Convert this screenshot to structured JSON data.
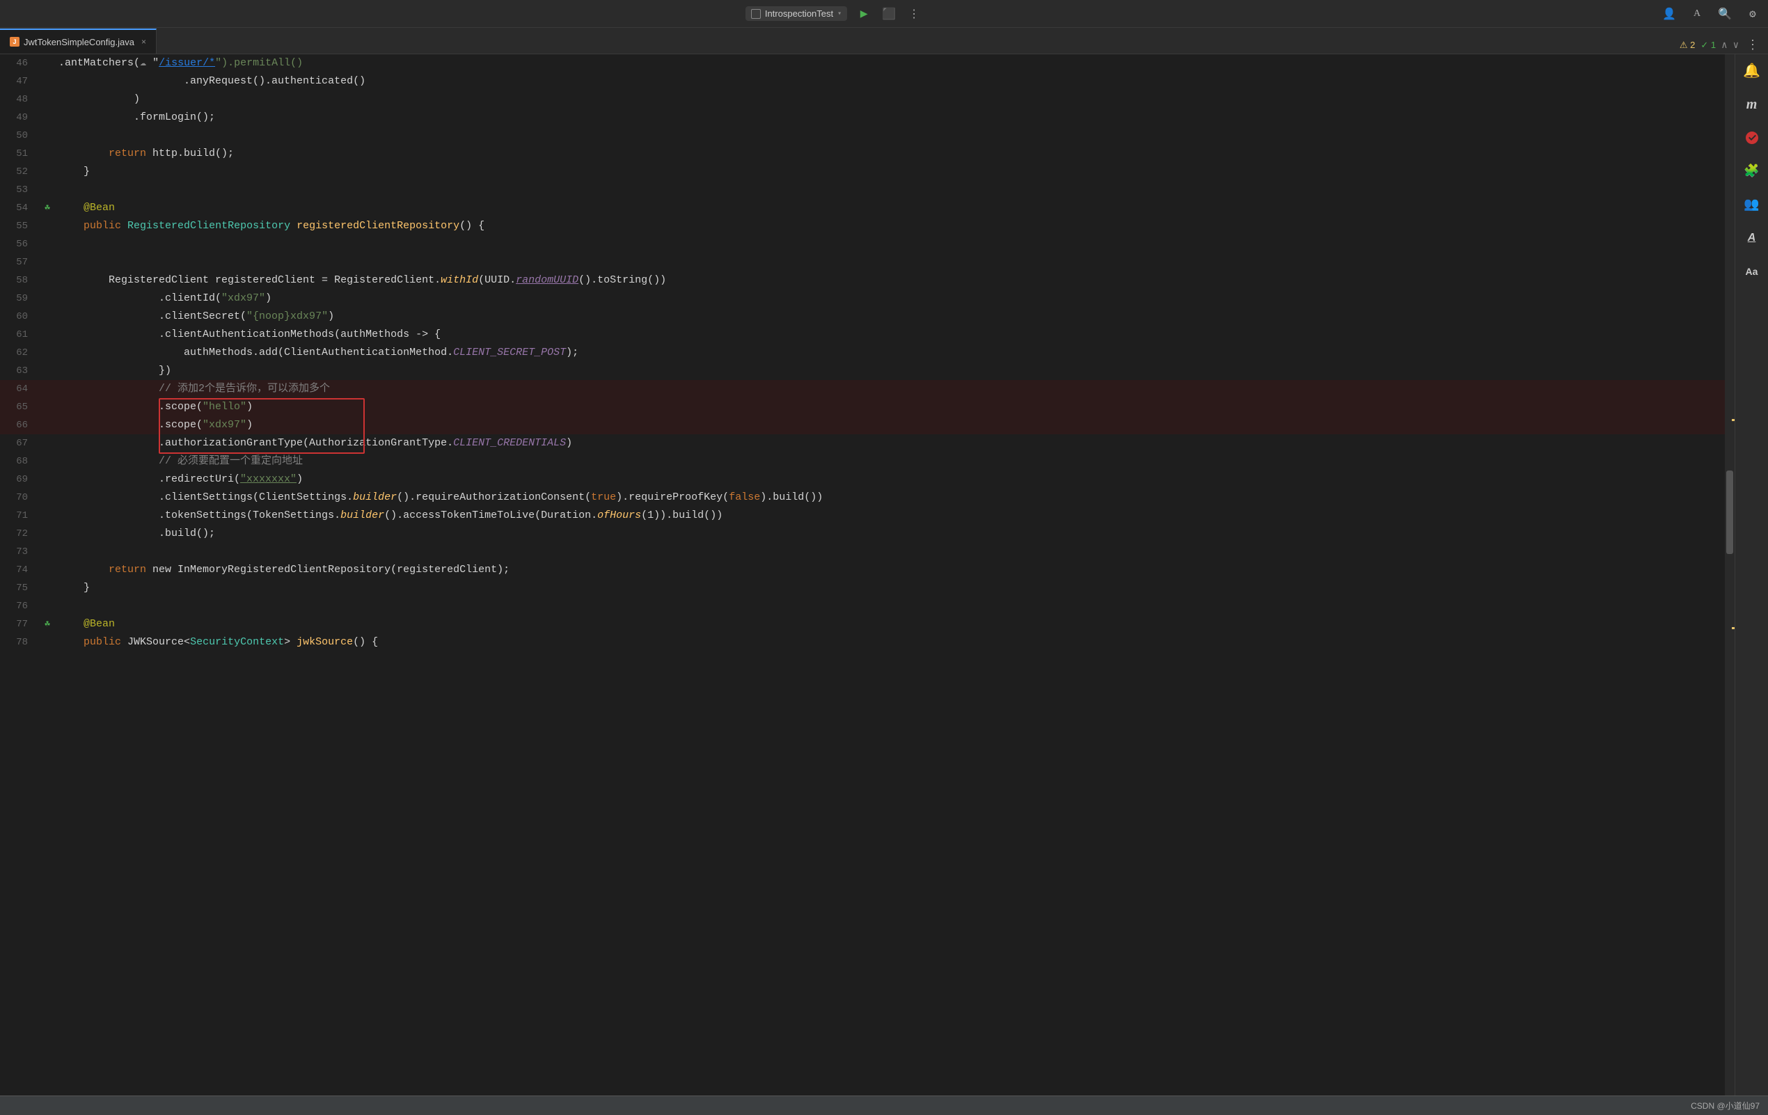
{
  "topbar": {
    "run_config_label": "IntrospectionTest",
    "run_icon": "▶",
    "debug_icon": "🐛",
    "more_icon": "⋮",
    "profile_icon": "👤",
    "font_icon": "A",
    "search_icon": "🔍",
    "settings_icon": "⚙"
  },
  "tab": {
    "filename": "JwtTokenSimpleConfig.java",
    "close_icon": "×",
    "more_icon": "⋮"
  },
  "warnings": {
    "warning_count": "⚠ 2",
    "ok_count": "✓ 1"
  },
  "code_lines": [
    {
      "num": "46",
      "gutter": "",
      "code": "                    .antMatchers(",
      "parts": [
        {
          "text": "                    .antMatchers(",
          "cls": ""
        },
        {
          "text": "☁",
          "cls": "comment"
        },
        {
          "text": " \"",
          "cls": ""
        },
        {
          "text": "/issuer/*",
          "cls": "link"
        },
        {
          "text": "\").permitAll()",
          "cls": "str2"
        }
      ]
    },
    {
      "num": "47",
      "gutter": "",
      "parts": [
        {
          "text": "                    .anyRequest().authenticated()",
          "cls": ""
        }
      ]
    },
    {
      "num": "48",
      "gutter": "",
      "parts": [
        {
          "text": "            )",
          "cls": ""
        }
      ]
    },
    {
      "num": "49",
      "gutter": "",
      "parts": [
        {
          "text": "            .formLogin();",
          "cls": ""
        }
      ]
    },
    {
      "num": "50",
      "gutter": "",
      "parts": [
        {
          "text": "",
          "cls": ""
        }
      ]
    },
    {
      "num": "51",
      "gutter": "",
      "parts": [
        {
          "text": "        ",
          "cls": ""
        },
        {
          "text": "return",
          "cls": "kw"
        },
        {
          "text": " http.build();",
          "cls": ""
        }
      ]
    },
    {
      "num": "52",
      "gutter": "",
      "parts": [
        {
          "text": "    }",
          "cls": ""
        }
      ]
    },
    {
      "num": "53",
      "gutter": "",
      "parts": [
        {
          "text": "",
          "cls": ""
        }
      ]
    },
    {
      "num": "54",
      "gutter": "bean",
      "parts": [
        {
          "text": "    ",
          "cls": ""
        },
        {
          "text": "@Bean",
          "cls": "ann"
        }
      ]
    },
    {
      "num": "55",
      "gutter": "",
      "parts": [
        {
          "text": "    ",
          "cls": ""
        },
        {
          "text": "public",
          "cls": "kw"
        },
        {
          "text": " RegisteredClientRepository ",
          "cls": "type"
        },
        {
          "text": "registeredClientRepository",
          "cls": "fn"
        },
        {
          "text": "() {",
          "cls": ""
        }
      ]
    },
    {
      "num": "56",
      "gutter": "",
      "parts": [
        {
          "text": "",
          "cls": ""
        }
      ]
    },
    {
      "num": "57",
      "gutter": "",
      "parts": [
        {
          "text": "",
          "cls": ""
        }
      ]
    },
    {
      "num": "58",
      "gutter": "",
      "parts": [
        {
          "text": "        RegisteredClient registeredClient = RegisteredClient.",
          "cls": ""
        },
        {
          "text": "withId",
          "cls": "method"
        },
        {
          "text": "(UUID.",
          "cls": ""
        },
        {
          "text": "randomUUID",
          "cls": "const-italic underline"
        },
        {
          "text": "().toString())",
          "cls": ""
        }
      ]
    },
    {
      "num": "59",
      "gutter": "",
      "parts": [
        {
          "text": "                .clientId(",
          "cls": ""
        },
        {
          "text": "\"xdx97\"",
          "cls": "str"
        },
        {
          "text": ")",
          "cls": ""
        }
      ]
    },
    {
      "num": "60",
      "gutter": "",
      "parts": [
        {
          "text": "                .clientSecret(",
          "cls": ""
        },
        {
          "text": "\"{noop}xdx97\"",
          "cls": "str"
        },
        {
          "text": ")",
          "cls": ""
        }
      ]
    },
    {
      "num": "61",
      "gutter": "",
      "parts": [
        {
          "text": "                .clientAuthenticationMethods(authMethods -> ",
          "cls": ""
        },
        {
          "text": "{",
          "cls": ""
        }
      ]
    },
    {
      "num": "62",
      "gutter": "",
      "parts": [
        {
          "text": "                    authMethods.add(ClientAuthenticationMethod.",
          "cls": ""
        },
        {
          "text": "CLIENT_SECRET_POST",
          "cls": "const-italic"
        },
        {
          "text": ");",
          "cls": ""
        }
      ]
    },
    {
      "num": "63",
      "gutter": "",
      "parts": [
        {
          "text": "                })",
          "cls": ""
        }
      ]
    },
    {
      "num": "64",
      "gutter": "",
      "parts": [
        {
          "text": "                ",
          "cls": ""
        },
        {
          "text": "// 添加2个是告诉你，可以添加多个",
          "cls": "comment"
        },
        {
          "text": "",
          "cls": ""
        }
      ]
    },
    {
      "num": "65",
      "gutter": "",
      "parts": [
        {
          "text": "                .scope(",
          "cls": ""
        },
        {
          "text": "\"hello\"",
          "cls": "str"
        },
        {
          "text": ")",
          "cls": ""
        }
      ]
    },
    {
      "num": "66",
      "gutter": "",
      "parts": [
        {
          "text": "                .scope(",
          "cls": ""
        },
        {
          "text": "\"xdx97\"",
          "cls": "str"
        },
        {
          "text": ")",
          "cls": ""
        }
      ]
    },
    {
      "num": "67",
      "gutter": "",
      "parts": [
        {
          "text": "                .authorizationGrantType(AuthorizationGrantType.",
          "cls": ""
        },
        {
          "text": "CLIENT_CREDENTIALS",
          "cls": "const-italic"
        },
        {
          "text": ")",
          "cls": ""
        }
      ]
    },
    {
      "num": "68",
      "gutter": "",
      "parts": [
        {
          "text": "                ",
          "cls": ""
        },
        {
          "text": "// 必须要配置一个重定向地址",
          "cls": "comment"
        }
      ]
    },
    {
      "num": "69",
      "gutter": "",
      "parts": [
        {
          "text": "                .redirectUri(",
          "cls": ""
        },
        {
          "text": "\"xxxxxxx\"",
          "cls": "str underline"
        },
        {
          "text": ")",
          "cls": ""
        }
      ]
    },
    {
      "num": "70",
      "gutter": "",
      "parts": [
        {
          "text": "                .clientSettings(ClientSettings.",
          "cls": ""
        },
        {
          "text": "builder",
          "cls": "method"
        },
        {
          "text": "().requireAuthorizationConsent(",
          "cls": ""
        },
        {
          "text": "true",
          "cls": "bool"
        },
        {
          "text": ").requireProofKey(",
          "cls": ""
        },
        {
          "text": "false",
          "cls": "bool"
        },
        {
          "text": ").build())",
          "cls": ""
        }
      ]
    },
    {
      "num": "71",
      "gutter": "",
      "parts": [
        {
          "text": "                .tokenSettings(TokenSettings.",
          "cls": ""
        },
        {
          "text": "builder",
          "cls": "method"
        },
        {
          "text": "().accessTokenTimeToLive(Duration.",
          "cls": ""
        },
        {
          "text": "ofHours",
          "cls": "method"
        },
        {
          "text": "(1)).build())",
          "cls": ""
        }
      ]
    },
    {
      "num": "72",
      "gutter": "",
      "parts": [
        {
          "text": "                .build();",
          "cls": ""
        }
      ]
    },
    {
      "num": "73",
      "gutter": "",
      "parts": [
        {
          "text": "",
          "cls": ""
        }
      ]
    },
    {
      "num": "74",
      "gutter": "",
      "parts": [
        {
          "text": "        ",
          "cls": ""
        },
        {
          "text": "return",
          "cls": "kw"
        },
        {
          "text": " new InMemoryRegisteredClientRepository(registeredClient);",
          "cls": ""
        }
      ]
    },
    {
      "num": "75",
      "gutter": "",
      "parts": [
        {
          "text": "    }",
          "cls": ""
        }
      ]
    },
    {
      "num": "76",
      "gutter": "",
      "parts": [
        {
          "text": "",
          "cls": ""
        }
      ]
    },
    {
      "num": "77",
      "gutter": "bean",
      "parts": [
        {
          "text": "    ",
          "cls": ""
        },
        {
          "text": "@Bean",
          "cls": "ann"
        }
      ]
    },
    {
      "num": "78",
      "gutter": "",
      "parts": [
        {
          "text": "    ",
          "cls": ""
        },
        {
          "text": "public",
          "cls": "kw"
        },
        {
          "text": " JWKSource<SecurityContext> ",
          "cls": "type"
        },
        {
          "text": "jwkSource",
          "cls": "fn"
        },
        {
          "text": "() {",
          "cls": ""
        }
      ]
    }
  ],
  "right_tools": [
    {
      "name": "database-icon",
      "symbol": "🗄"
    },
    {
      "name": "maven-icon",
      "symbol": "m"
    },
    {
      "name": "spring-icon",
      "symbol": "🌿"
    },
    {
      "name": "ai-icon",
      "symbol": "🤖"
    },
    {
      "name": "copilot-icon",
      "symbol": "👥"
    },
    {
      "name": "translate-icon",
      "symbol": "A"
    },
    {
      "name": "spell-icon",
      "symbol": "Aa"
    }
  ],
  "status_bar": {
    "text": "CSDN @小道仙97"
  }
}
